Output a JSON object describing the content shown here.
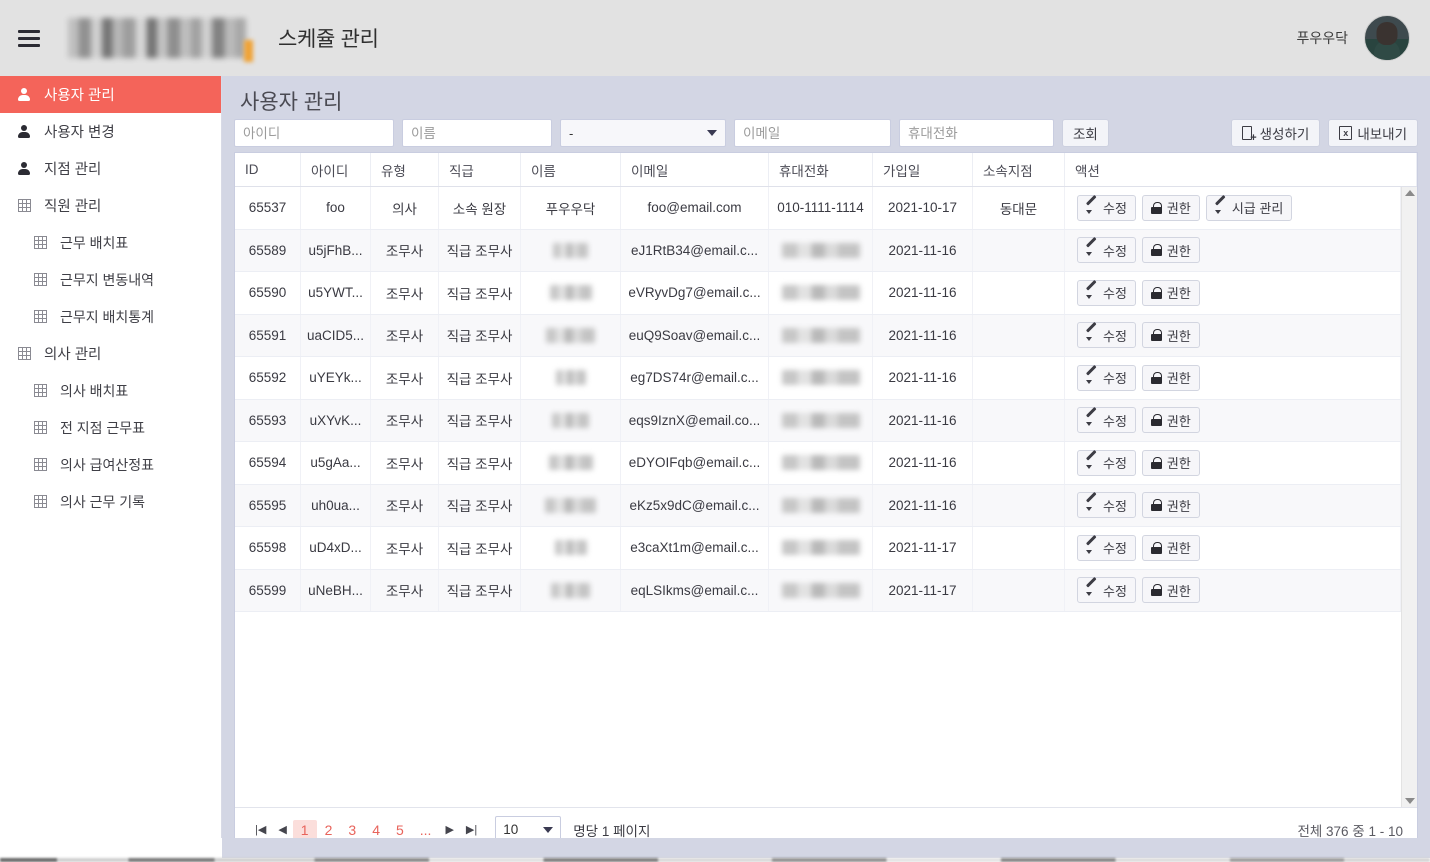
{
  "colors": {
    "accent": "#f4645a",
    "pagination_accent": "#e8635b",
    "topbar_bg": "#e2e2e2",
    "main_bg": "#d3d6e4",
    "logo_accent": "#f0a336"
  },
  "topbar": {
    "menu_icon": "hamburger-icon",
    "logo_alt": "company-logo-redacted",
    "app_title": "스케쥴 관리",
    "user_name": "푸우우닥",
    "avatar_alt": "user-avatar-photo"
  },
  "sidebar": {
    "items": [
      {
        "label": "사용자 관리",
        "icon": "person-icon",
        "active": true,
        "child": false
      },
      {
        "label": "사용자 변경",
        "icon": "person-icon",
        "active": false,
        "child": false
      },
      {
        "label": "지점 관리",
        "icon": "person-icon",
        "active": false,
        "child": false
      },
      {
        "label": "직원 관리",
        "icon": "grid-icon",
        "active": false,
        "child": false
      },
      {
        "label": "근무 배치표",
        "icon": "grid-icon",
        "active": false,
        "child": true
      },
      {
        "label": "근무지 변동내역",
        "icon": "grid-icon",
        "active": false,
        "child": true
      },
      {
        "label": "근무지 배치통계",
        "icon": "grid-icon",
        "active": false,
        "child": true
      },
      {
        "label": "의사 관리",
        "icon": "grid-icon",
        "active": false,
        "child": false
      },
      {
        "label": "의사 배치표",
        "icon": "grid-icon",
        "active": false,
        "child": true
      },
      {
        "label": "전 지점 근무표",
        "icon": "grid-icon",
        "active": false,
        "child": true
      },
      {
        "label": "의사 급여산정표",
        "icon": "grid-icon",
        "active": false,
        "child": true
      },
      {
        "label": "의사 근무 기록",
        "icon": "grid-icon",
        "active": false,
        "child": true
      }
    ]
  },
  "main": {
    "page_title": "사용자 관리",
    "filters": {
      "id_placeholder": "아이디",
      "id_value": "",
      "name_placeholder": "이름",
      "name_value": "",
      "type_selected": "-",
      "email_placeholder": "이메일",
      "email_value": "",
      "phone_placeholder": "휴대전화",
      "phone_value": "",
      "search_label": "조회",
      "create_label": "생성하기",
      "create_icon": "document-plus-icon",
      "export_label": "내보내기",
      "export_icon": "spreadsheet-icon"
    },
    "table": {
      "columns": [
        "ID",
        "아이디",
        "유형",
        "직급",
        "이름",
        "이메일",
        "휴대전화",
        "가입일",
        "소속지점",
        "액션"
      ],
      "rows": [
        {
          "id": "65537",
          "account": "foo",
          "type": "의사",
          "rank": "소속 원장",
          "name": "푸우우닥",
          "name_redacted": false,
          "email": "foo@email.com",
          "phone": "010-1111-1114",
          "phone_redacted": false,
          "joined": "2021-10-17",
          "branch": "동대문",
          "actions": [
            "수정",
            "권한",
            "시급 관리"
          ]
        },
        {
          "id": "65589",
          "account": "u5jFhB...",
          "type": "조무사",
          "rank": "직급 조무사",
          "name": "",
          "name_redacted": true,
          "email": "eJ1RtB34@email.c...",
          "phone": "",
          "phone_redacted": true,
          "joined": "2021-11-16",
          "branch": "",
          "actions": [
            "수정",
            "권한"
          ]
        },
        {
          "id": "65590",
          "account": "u5YWT...",
          "type": "조무사",
          "rank": "직급 조무사",
          "name": "",
          "name_redacted": true,
          "email": "eVRyvDg7@email.c...",
          "phone": "",
          "phone_redacted": true,
          "joined": "2021-11-16",
          "branch": "",
          "actions": [
            "수정",
            "권한"
          ]
        },
        {
          "id": "65591",
          "account": "uaCID5...",
          "type": "조무사",
          "rank": "직급 조무사",
          "name": "",
          "name_redacted": true,
          "email": "euQ9Soav@email.c...",
          "phone": "",
          "phone_redacted": true,
          "joined": "2021-11-16",
          "branch": "",
          "actions": [
            "수정",
            "권한"
          ]
        },
        {
          "id": "65592",
          "account": "uYEYk...",
          "type": "조무사",
          "rank": "직급 조무사",
          "name": "",
          "name_redacted": true,
          "email": "eg7DS74r@email.c...",
          "phone": "",
          "phone_redacted": true,
          "joined": "2021-11-16",
          "branch": "",
          "actions": [
            "수정",
            "권한"
          ]
        },
        {
          "id": "65593",
          "account": "uXYvK...",
          "type": "조무사",
          "rank": "직급 조무사",
          "name": "",
          "name_redacted": true,
          "email": "eqs9IznX@email.co...",
          "phone": "",
          "phone_redacted": true,
          "joined": "2021-11-16",
          "branch": "",
          "actions": [
            "수정",
            "권한"
          ]
        },
        {
          "id": "65594",
          "account": "u5gAa...",
          "type": "조무사",
          "rank": "직급 조무사",
          "name": "",
          "name_redacted": true,
          "email": "eDYOIFqb@email.c...",
          "phone": "",
          "phone_redacted": true,
          "joined": "2021-11-16",
          "branch": "",
          "actions": [
            "수정",
            "권한"
          ]
        },
        {
          "id": "65595",
          "account": "uh0ua...",
          "type": "조무사",
          "rank": "직급 조무사",
          "name": "",
          "name_redacted": true,
          "email": "eKz5x9dC@email.c...",
          "phone": "",
          "phone_redacted": true,
          "joined": "2021-11-16",
          "branch": "",
          "actions": [
            "수정",
            "권한"
          ]
        },
        {
          "id": "65598",
          "account": "uD4xD...",
          "type": "조무사",
          "rank": "직급 조무사",
          "name": "",
          "name_redacted": true,
          "email": "e3caXt1m@email.c...",
          "phone": "",
          "phone_redacted": true,
          "joined": "2021-11-17",
          "branch": "",
          "actions": [
            "수정",
            "권한"
          ]
        },
        {
          "id": "65599",
          "account": "uNeBH...",
          "type": "조무사",
          "rank": "직급 조무사",
          "name": "",
          "name_redacted": true,
          "email": "eqLSIkms@email.c...",
          "phone": "",
          "phone_redacted": true,
          "joined": "2021-11-17",
          "branch": "",
          "actions": [
            "수정",
            "권한"
          ]
        }
      ]
    },
    "pagination": {
      "first_icon": "first-page-icon",
      "prev_icon": "prev-page-icon",
      "pages": [
        "1",
        "2",
        "3",
        "4",
        "5"
      ],
      "ellipsis": "...",
      "next_icon": "next-page-icon",
      "last_icon": "last-page-icon",
      "current_page": "1",
      "page_size": "10",
      "per_page_label": "명당 1 페이지",
      "total_label": "전체 376 중 1 - 10"
    }
  }
}
